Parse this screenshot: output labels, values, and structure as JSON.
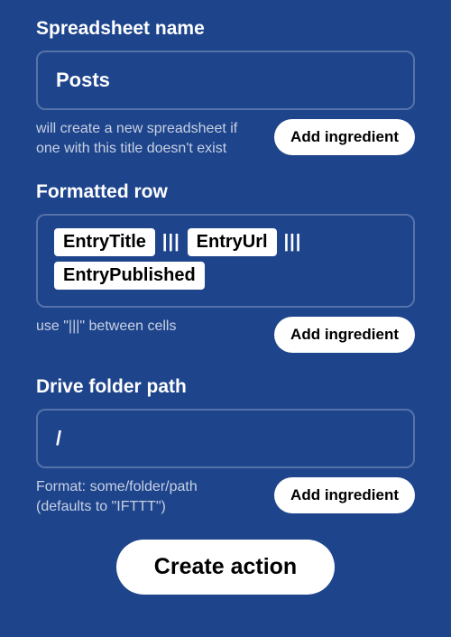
{
  "fields": {
    "spreadsheet": {
      "label": "Spreadsheet name",
      "value": "Posts",
      "help": "will create a new spreadsheet if one with this title doesn't exist",
      "add_ingredient_label": "Add ingredient"
    },
    "formatted_row": {
      "label": "Formatted row",
      "tokens": [
        "EntryTitle",
        "EntryUrl",
        "EntryPublished"
      ],
      "separator": "|||",
      "help": "use \"|||\" between cells",
      "add_ingredient_label": "Add ingredient"
    },
    "drive_folder": {
      "label": "Drive folder path",
      "value": "/",
      "help": "Format: some/folder/path (defaults to \"IFTTT\")",
      "add_ingredient_label": "Add ingredient"
    }
  },
  "create_action_label": "Create action"
}
